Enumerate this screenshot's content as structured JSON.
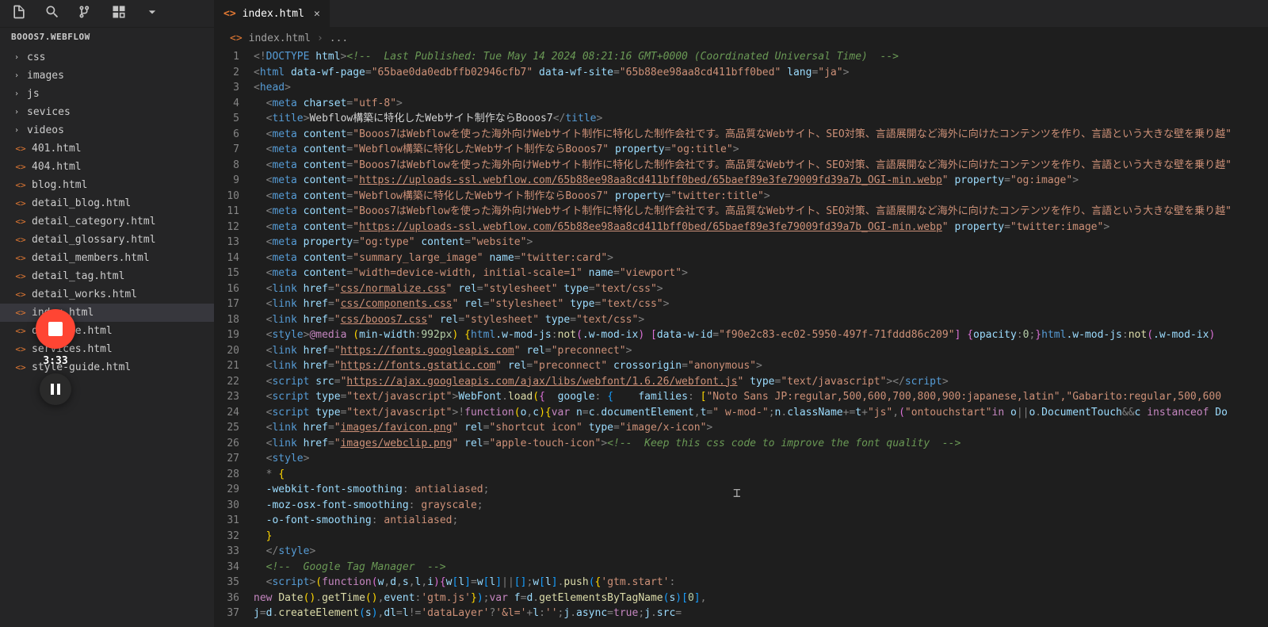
{
  "activeTab": "index.html",
  "breadcrumb": {
    "file": "index.html",
    "more": "..."
  },
  "sidebar": {
    "header": "BOOOS7.WEBFLOW",
    "items": [
      {
        "name": "css",
        "type": "folder"
      },
      {
        "name": "images",
        "type": "folder"
      },
      {
        "name": "js",
        "type": "folder"
      },
      {
        "name": "sevices",
        "type": "folder"
      },
      {
        "name": "videos",
        "type": "folder"
      },
      {
        "name": "401.html",
        "type": "html"
      },
      {
        "name": "404.html",
        "type": "html"
      },
      {
        "name": "blog.html",
        "type": "html"
      },
      {
        "name": "detail_blog.html",
        "type": "html"
      },
      {
        "name": "detail_category.html",
        "type": "html"
      },
      {
        "name": "detail_glossary.html",
        "type": "html"
      },
      {
        "name": "detail_members.html",
        "type": "html"
      },
      {
        "name": "detail_tag.html",
        "type": "html"
      },
      {
        "name": "detail_works.html",
        "type": "html"
      },
      {
        "name": "index.html",
        "type": "html",
        "selected": true
      },
      {
        "name": "old-home.html",
        "type": "html"
      },
      {
        "name": "services.html",
        "type": "html"
      },
      {
        "name": "style-guide.html",
        "type": "html"
      }
    ]
  },
  "recorder": {
    "time": "3:33"
  },
  "lineNumbers": [
    "1",
    "2",
    "3",
    "4",
    "5",
    "6",
    "7",
    "8",
    "9",
    "10",
    "11",
    "12",
    "13",
    "14",
    "15",
    "16",
    "17",
    "18",
    "19",
    "20",
    "21",
    "22",
    "23",
    "24",
    "25",
    "26",
    "27",
    "28",
    "29",
    "30",
    "31",
    "32",
    "33",
    "34",
    "35",
    "36",
    "37"
  ],
  "code": {
    "l1_comment": "<!--  Last Published: Tue May 14 2024 08:21:16 GMT+0000 (Coordinated Universal Time)  -->",
    "l2_page": "65bae0da0edbffb02946cfb7",
    "l2_site": "65b88ee98aa8cd411bff0bed",
    "l2_lang": "ja",
    "l5_title": "Webflow構築に特化したWebサイト制作ならBooos7",
    "l6_content": "Booos7はWebflowを使った海外向けWebサイト制作に特化した制作会社です。高品質なWebサイト、SEO対策、言語展開など海外に向けたコンテンツを作り、言語という大きな壁を乗り越",
    "l7_content": "Webflow構築に特化したWebサイト制作ならBooos7",
    "l8_content": "Booos7はWebflowを使った海外向けWebサイト制作に特化した制作会社です。高品質なWebサイト、SEO対策、言語展開など海外に向けたコンテンツを作り、言語という大きな壁を乗り越",
    "l9_img": "https://uploads-ssl.webflow.com/65b88ee98aa8cd411bff0bed/65baef89e3fe79009fd39a7b_OGI-min.webp",
    "l10_content": "Webflow構築に特化したWebサイト制作ならBooos7",
    "l11_content": "Booos7はWebflowを使った海外向けWebサイト制作に特化した制作会社です。高品質なWebサイト、SEO対策、言語展開など海外に向けたコンテンツを作り、言語という大きな壁を乗り越",
    "l12_img": "https://uploads-ssl.webflow.com/65b88ee98aa8cd411bff0bed/65baef89e3fe79009fd39a7b_OGI-min.webp",
    "l16_href": "css/normalize.css",
    "l17_href": "css/components.css",
    "l18_href": "css/booos7.css",
    "l19_wid": "f90e2c83-ec02-5950-497f-71fddd86c209",
    "l20_href": "https://fonts.googleapis.com",
    "l21_href": "https://fonts.gstatic.com",
    "l22_src": "https://ajax.googleapis.com/ajax/libs/webfont/1.6.26/webfont.js",
    "l23_families": "\"Noto Sans JP:regular,500,600,700,800,900:japanese,latin\",\"Gabarito:regular,500,600",
    "l25_href": "images/favicon.png",
    "l26_href": "images/webclip.png",
    "l26_comment": "<!--  Keep this css code to improve the font quality  -->",
    "l34_comment": "<!--  Google Tag Manager  -->"
  }
}
